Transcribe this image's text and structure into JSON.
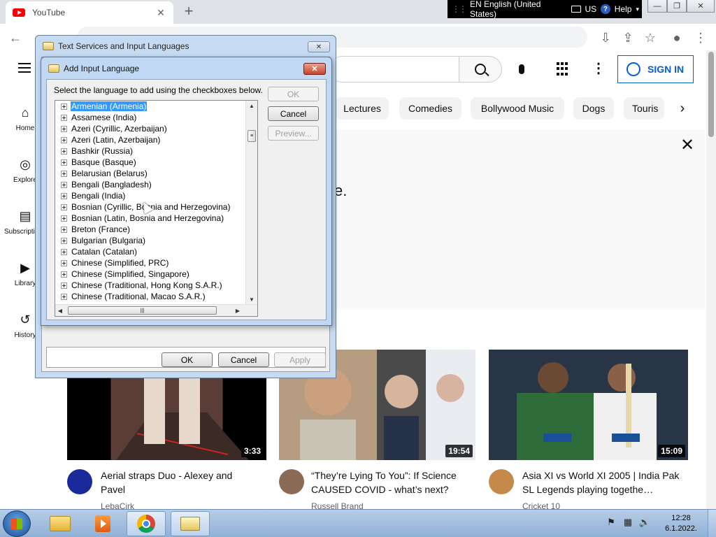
{
  "browser": {
    "tab_title": "YouTube",
    "tab_close_glyph": "✕",
    "new_tab_glyph": "+"
  },
  "language_bar": {
    "language": "EN English (United States)",
    "layout": "US",
    "help": "Help",
    "help_glyph": "?"
  },
  "window_controls": {
    "minimize": "—",
    "restore": "❐",
    "close": "✕"
  },
  "youtube": {
    "sign_in": "SIGN IN",
    "sidebar": [
      {
        "label": "Home",
        "icon": "home-icon",
        "glyph": "⌂"
      },
      {
        "label": "Explore",
        "icon": "compass-icon",
        "glyph": "◎"
      },
      {
        "label": "Subscriptions",
        "icon": "subscriptions-icon",
        "glyph": "▤"
      },
      {
        "label": "Library",
        "icon": "library-icon",
        "glyph": "▶"
      },
      {
        "label": "History",
        "icon": "history-icon",
        "glyph": "↺"
      }
    ],
    "chips": [
      "Lectures",
      "Comedies",
      "Bollywood Music",
      "Dogs",
      "Touris"
    ],
    "notice_close": "✕",
    "notice_text": "e.",
    "videos": [
      {
        "title": "Aerial straps Duo - Alexey and Pavel",
        "channel": "LebaCirk",
        "duration": "3:33"
      },
      {
        "title": "“They’re Lying To You”: If Science CAUSED COVID - what’s next?",
        "channel": "Russell Brand",
        "duration": "19:54"
      },
      {
        "title": "Asia XI vs World XI 2005 | India Pak SL Legends playing togethe…",
        "channel": "Cricket 10",
        "duration": "15:09"
      }
    ]
  },
  "outer_dialog": {
    "title": "Text Services and Input Languages",
    "close": "✕",
    "ok": "OK",
    "cancel": "Cancel",
    "apply": "Apply"
  },
  "inner_dialog": {
    "title": "Add Input Language",
    "close": "✕",
    "instruction": "Select the language to add using the checkboxes below.",
    "ok": "OK",
    "cancel": "Cancel",
    "preview": "Preview...",
    "languages": [
      "Armenian (Armenia)",
      "Assamese (India)",
      "Azeri (Cyrillic, Azerbaijan)",
      "Azeri (Latin, Azerbaijan)",
      "Bashkir (Russia)",
      "Basque (Basque)",
      "Belarusian (Belarus)",
      "Bengali (Bangladesh)",
      "Bengali (India)",
      "Bosnian (Cyrillic, Bosnia and Herzegovina)",
      "Bosnian (Latin, Bosnia and Herzegovina)",
      "Breton (France)",
      "Bulgarian (Bulgaria)",
      "Catalan (Catalan)",
      "Chinese (Simplified, PRC)",
      "Chinese (Simplified, Singapore)",
      "Chinese (Traditional, Hong Kong S.A.R.)",
      "Chinese (Traditional, Macao S.A.R.)"
    ],
    "selected_index": 0
  },
  "taskbar": {
    "time": "12:28",
    "date": "6.1.2022."
  }
}
